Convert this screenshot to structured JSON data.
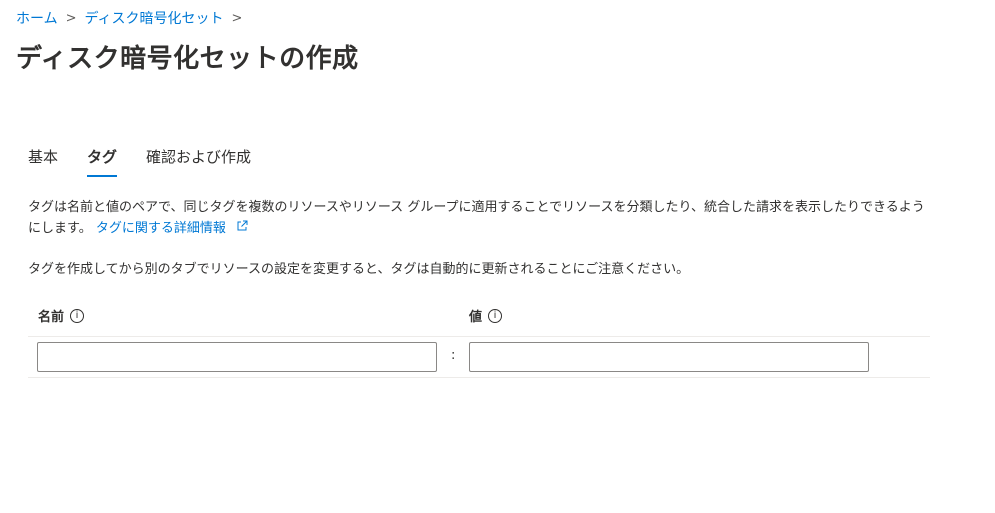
{
  "breadcrumb": {
    "home": "ホーム",
    "current": "ディスク暗号化セット",
    "separator": ">"
  },
  "page": {
    "title": "ディスク暗号化セットの作成"
  },
  "tabs": [
    {
      "label": "基本",
      "active": false
    },
    {
      "label": "タグ",
      "active": true
    },
    {
      "label": "確認および作成",
      "active": false
    }
  ],
  "description": {
    "text": "タグは名前と値のペアで、同じタグを複数のリソースやリソース グループに適用することでリソースを分類したり、統合した請求を表示したりできるようにします。",
    "link_text": "タグに関する詳細情報"
  },
  "note": "タグを作成してから別のタブでリソースの設定を変更すると、タグは自動的に更新されることにご注意ください。",
  "tag_table": {
    "name_header": "名前",
    "value_header": "値",
    "info_glyph": "i",
    "separator": ":",
    "name_value": "",
    "value_value": ""
  },
  "colors": {
    "accent": "#0078d4",
    "text": "#323130",
    "border": "#8a8886"
  }
}
